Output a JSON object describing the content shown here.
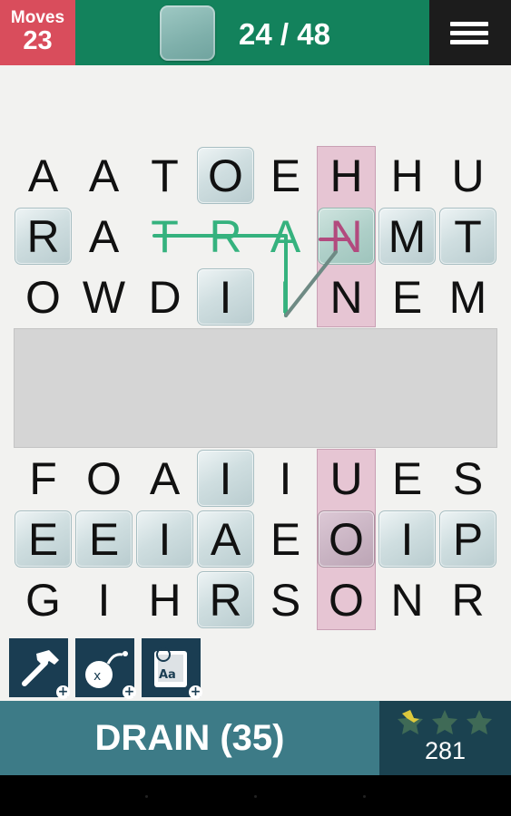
{
  "header": {
    "moves_label": "Moves",
    "moves_count": "23",
    "progress_text": "24 / 48"
  },
  "colors": {
    "moves_bg": "#d94d5c",
    "progress_bg": "#13825c",
    "word_bar_bg": "#3d7b87",
    "score_bg": "#1b4250",
    "highlight_column": "#e6c5d3",
    "path_green": "#35b27e",
    "path_pink": "#b24a7e"
  },
  "grid": {
    "top_rows": [
      [
        "A",
        "A",
        "T",
        "O",
        "E",
        "H",
        "H",
        "U"
      ],
      [
        "R",
        "A",
        "D",
        "R",
        "A",
        "N",
        "M",
        "T"
      ],
      [
        "O",
        "W",
        "D",
        "I",
        "I",
        "N",
        "E",
        "M"
      ]
    ],
    "bottom_rows": [
      [
        "F",
        "O",
        "A",
        "I",
        "I",
        "U",
        "E",
        "S"
      ],
      [
        "E",
        "E",
        "I",
        "A",
        "E",
        "O",
        "I",
        "P"
      ],
      [
        "G",
        "I",
        "H",
        "R",
        "S",
        "O",
        "N",
        "R"
      ]
    ]
  },
  "current_word": {
    "text": "DRAIN (35)",
    "score": "281",
    "stars_earned": 0.3,
    "stars_total": 3
  },
  "powerups": [
    {
      "name": "hammer",
      "icon": "hammer-icon"
    },
    {
      "name": "bomb",
      "icon": "bomb-icon"
    },
    {
      "name": "dictionary",
      "icon": "dictionary-icon",
      "icon_text": "Aa"
    }
  ]
}
